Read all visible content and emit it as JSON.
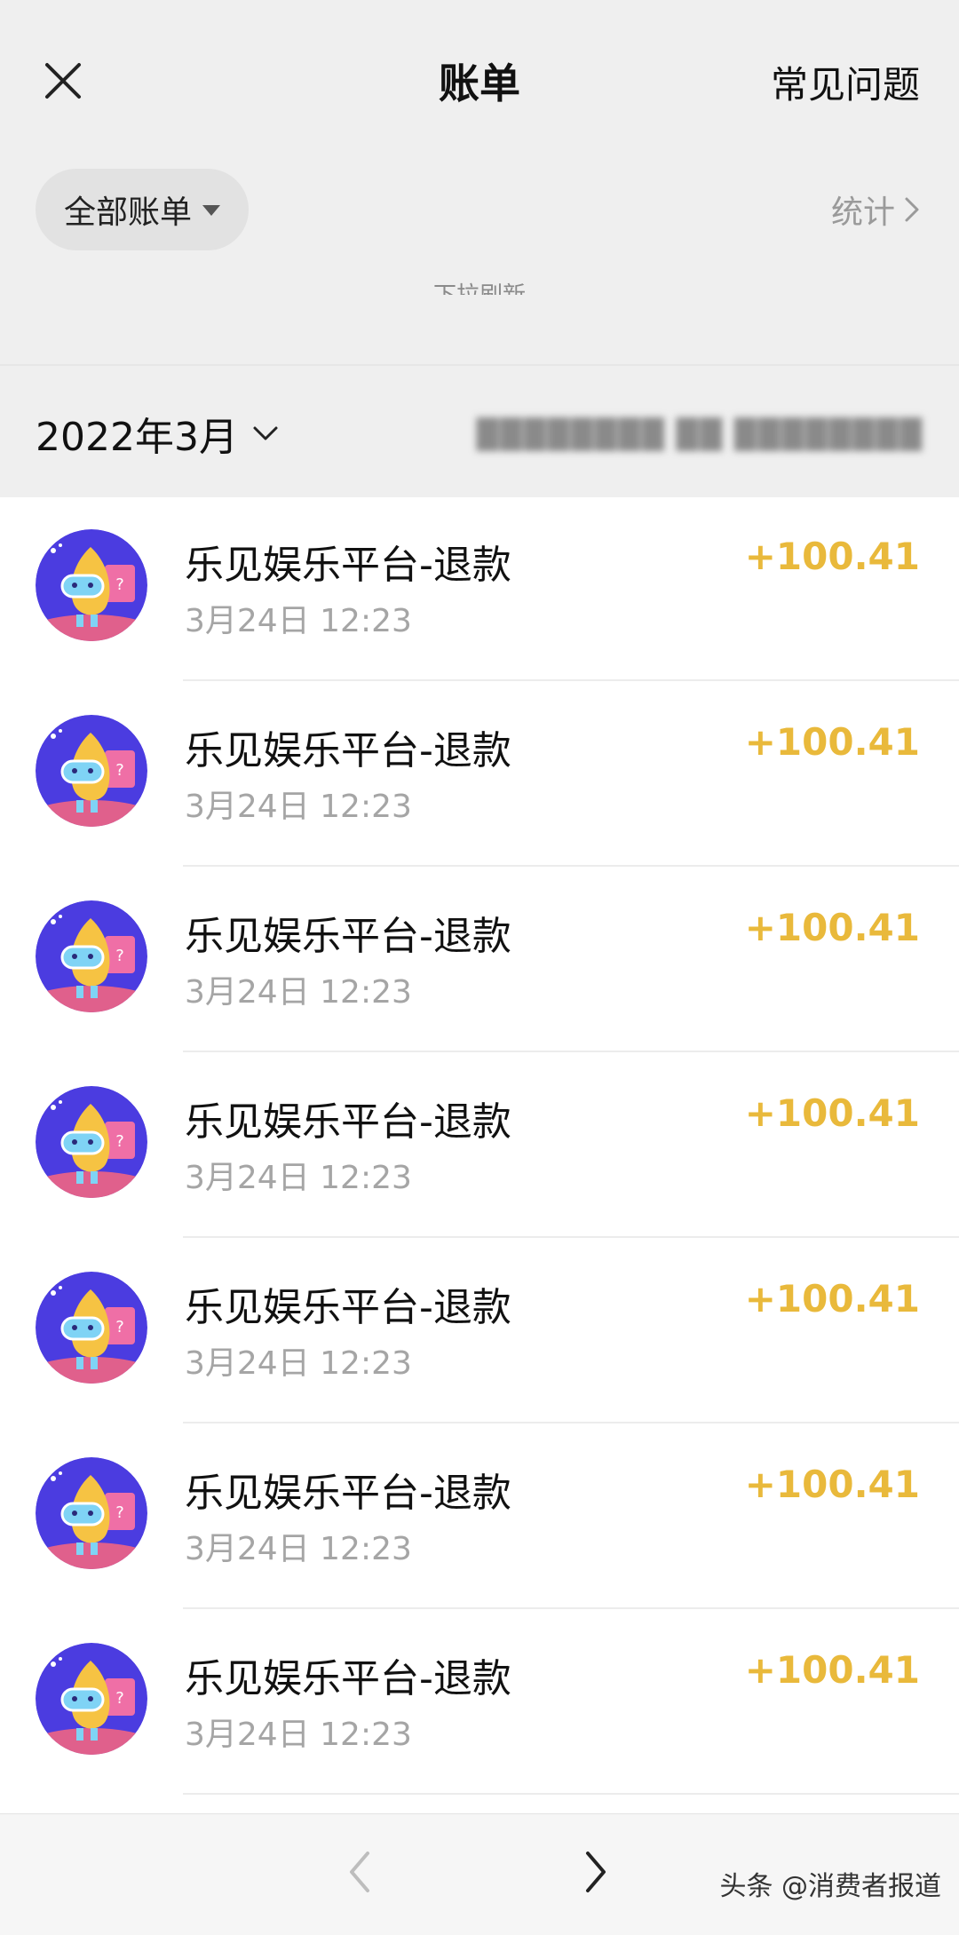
{
  "header": {
    "title": "账单",
    "faq": "常见问题",
    "close_icon": "close-icon"
  },
  "filter": {
    "label": "全部账单",
    "stats": "统计"
  },
  "pull_refresh": "下拉刷新",
  "month_bar": {
    "month": "2022年3月"
  },
  "transactions": [
    {
      "title": "乐见娱乐平台-退款",
      "time": "3月24日 12:23",
      "amount": "+100.41"
    },
    {
      "title": "乐见娱乐平台-退款",
      "time": "3月24日 12:23",
      "amount": "+100.41"
    },
    {
      "title": "乐见娱乐平台-退款",
      "time": "3月24日 12:23",
      "amount": "+100.41"
    },
    {
      "title": "乐见娱乐平台-退款",
      "time": "3月24日 12:23",
      "amount": "+100.41"
    },
    {
      "title": "乐见娱乐平台-退款",
      "time": "3月24日 12:23",
      "amount": "+100.41"
    },
    {
      "title": "乐见娱乐平台-退款",
      "time": "3月24日 12:23",
      "amount": "+100.41"
    },
    {
      "title": "乐见娱乐平台-退款",
      "time": "3月24日 12:23",
      "amount": "+100.41"
    }
  ],
  "footer": {
    "watermark": "头条 @消费者报道"
  },
  "colors": {
    "amount": "#e9b93b",
    "background": "#efefef",
    "avatar_bg": "#4b3ce0"
  }
}
